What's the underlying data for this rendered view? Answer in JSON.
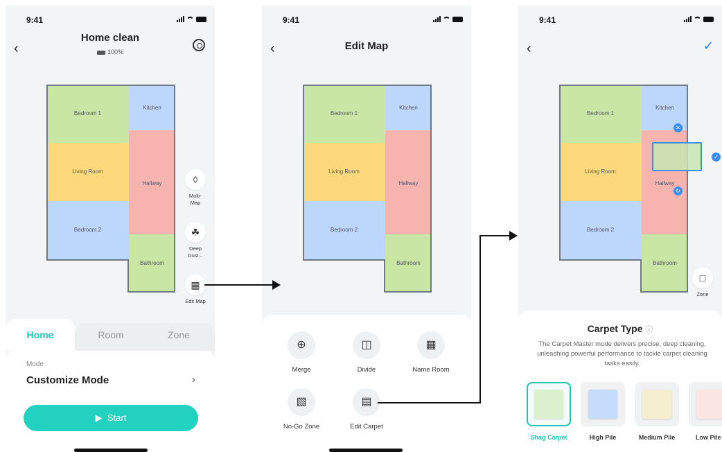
{
  "status_time": "9:41",
  "screen1": {
    "title": "Home clean",
    "battery": "100%",
    "rooms": {
      "bedroom1": "Bedroom 1",
      "kitchen": "Kitchen",
      "living": "Living Room",
      "hallway": "Hallway",
      "bedroom2": "Bedroom 2",
      "bathroom": "Bathroom"
    },
    "side_buttons": {
      "multimap": "Multi-\nMap",
      "deepdust": "Deep\nDust...",
      "editmap": "Edit Map"
    },
    "tabs": [
      "Home",
      "Room",
      "Zone"
    ],
    "mode_label": "Mode",
    "mode_value": "Customize Mode",
    "start": "Start"
  },
  "screen2": {
    "title": "Edit Map",
    "tools": [
      "Merge",
      "Divide",
      "Name Room",
      "No-Go Zone",
      "Edit Carpet"
    ]
  },
  "screen3": {
    "zone_label": "Zone",
    "carpet_title": "Carpet Type",
    "carpet_desc": "The Carpet Master mode delivers precise, deep cleaning, unleashing powerful performance to tackle carpet cleaning tasks easily.",
    "carpets": [
      "Shag Carpet",
      "High Pile",
      "Medium Pile",
      "Low Pile"
    ]
  },
  "colors": {
    "accent": "#1fc4b4",
    "button": "#22d1c0",
    "select_blue": "#3b8ff0"
  },
  "icons": [
    "back-icon",
    "settings-icon",
    "layers-icon",
    "dust-icon",
    "map-icon",
    "play-icon",
    "merge-icon",
    "divide-icon",
    "name-room-icon",
    "no-go-icon",
    "edit-carpet-icon",
    "check-icon",
    "zone-add-icon",
    "info-icon"
  ]
}
